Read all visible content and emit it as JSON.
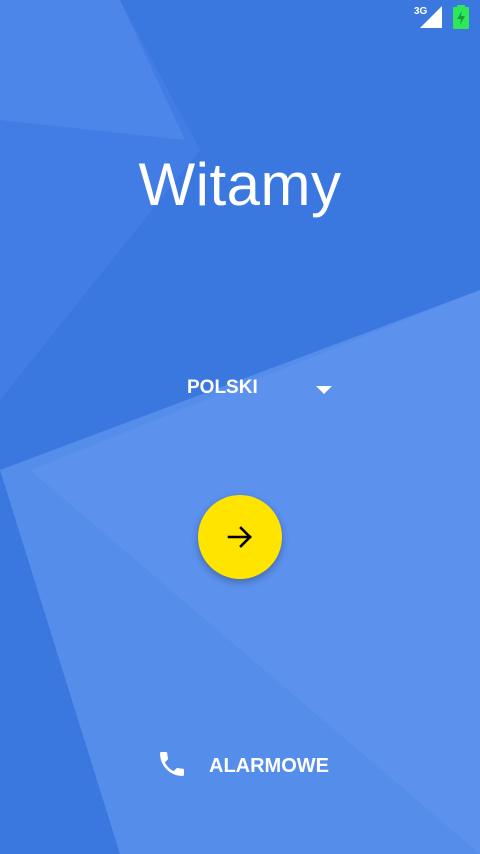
{
  "status_bar": {
    "network_type": "3G",
    "signal_icon": "cell-signal-icon",
    "battery_icon": "battery-charging-icon",
    "battery_color": "#2ee85a"
  },
  "welcome": {
    "title": "Witamy"
  },
  "language": {
    "selected": "POLSKI",
    "icon": "dropdown-arrow-icon"
  },
  "next_button": {
    "icon": "arrow-right-icon",
    "color": "#ffe400"
  },
  "emergency": {
    "label": "ALARMOWE",
    "icon": "phone-icon"
  },
  "colors": {
    "background": "#3a78e0",
    "accent": "#ffe400",
    "text": "#ffffff"
  }
}
